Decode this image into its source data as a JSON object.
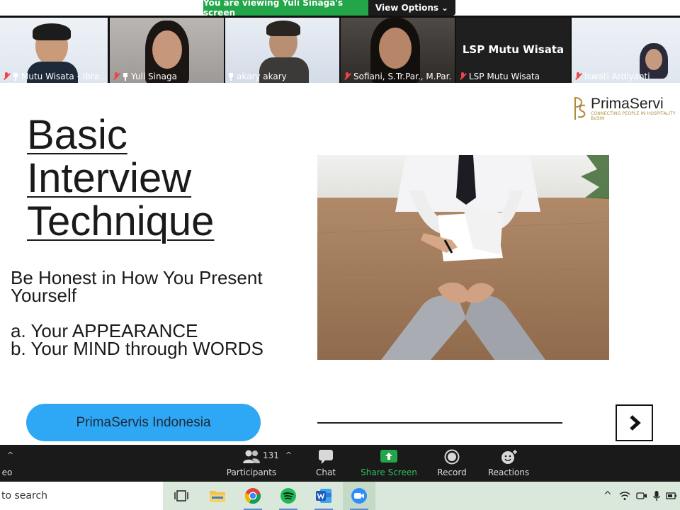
{
  "banner": {
    "viewing_text": "You are viewing Yuli Sinaga's screen",
    "view_options_label": "View Options"
  },
  "participants_strip": [
    {
      "name": "Mutu Wisata - Ibra...",
      "muted": true,
      "pinned": true
    },
    {
      "name": "Yuli Sinaga",
      "muted": true,
      "pinned": true
    },
    {
      "name": "akary akary",
      "muted": false,
      "pinned": true,
      "active": true
    },
    {
      "name": "Sofiani, S.Tr.Par., M.Par.",
      "muted": true,
      "pinned": false
    },
    {
      "name": "LSP Mutu Wisata",
      "muted": true,
      "pinned": false,
      "display_text": "LSP Mutu Wisata"
    },
    {
      "name": "iswati Ardiyanti",
      "muted": true,
      "pinned": false
    }
  ],
  "slide": {
    "logo_name": "PrimaServi",
    "logo_tagline": "CONNECTING PEOPLE IN HOSPITALITY BUSIN",
    "title_lines": [
      "Basic",
      "Interview",
      "Technique"
    ],
    "body_line1": "Be Honest in How You Present",
    "body_line2": "Yourself",
    "item_a": "a. Your APPEARANCE",
    "item_b": "b. Your MIND through WORDS",
    "brand_button": "PrimaServis Indonesia"
  },
  "toolbar": {
    "left_label": "eo",
    "participants_count": "131",
    "participants_label": "Participants",
    "chat_label": "Chat",
    "share_label": "Share Screen",
    "record_label": "Record",
    "reactions_label": "Reactions",
    "share_color": "#23a64a"
  },
  "taskbar": {
    "search_text": "to search",
    "apps": [
      "task-view",
      "file-explorer",
      "chrome",
      "spotify",
      "word",
      "zoom"
    ]
  }
}
